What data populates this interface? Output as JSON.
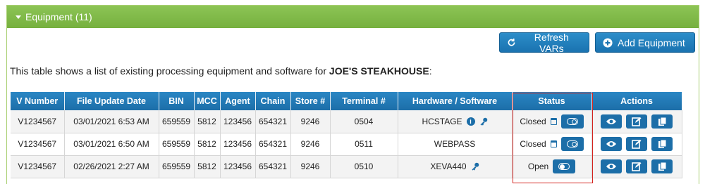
{
  "panel": {
    "title": "Equipment (11)"
  },
  "toolbar": {
    "refresh_label": "Refresh VARs",
    "add_label": "Add Equipment"
  },
  "intro": {
    "text": "This table shows a list of existing processing equipment and software for ",
    "merchant": "JOE'S STEAKHOUSE",
    "suffix": ":"
  },
  "table": {
    "headers": [
      "V Number",
      "File Update Date",
      "BIN",
      "MCC",
      "Agent",
      "Chain",
      "Store #",
      "Terminal #",
      "Hardware / Software",
      "Status",
      "Actions"
    ],
    "rows": [
      {
        "v_number": "V1234567",
        "file_update_date": "03/01/2021 6:53 AM",
        "bin": "659559",
        "mcc": "5812",
        "agent": "123456",
        "chain": "654321",
        "store": "9246",
        "terminal": "0504",
        "hardware": "HCSTAGE",
        "status": "Closed"
      },
      {
        "v_number": "V1234567",
        "file_update_date": "03/01/2021 6:50 AM",
        "bin": "659559",
        "mcc": "5812",
        "agent": "123456",
        "chain": "654321",
        "store": "9246",
        "terminal": "0511",
        "hardware": "WEBPASS",
        "status": "Closed"
      },
      {
        "v_number": "V1234567",
        "file_update_date": "02/26/2021 2:27 AM",
        "bin": "659559",
        "mcc": "5812",
        "agent": "123456",
        "chain": "654321",
        "store": "9246",
        "terminal": "0510",
        "hardware": "XEVA440",
        "status": "Open"
      }
    ]
  },
  "colors": {
    "header_green": "#7ab844",
    "primary_blue": "#1c6ea8",
    "highlight_red": "#d3231e"
  },
  "icons": {
    "refresh": "refresh-icon",
    "add": "plus-circle-icon",
    "info": "info-icon",
    "key": "key-icon",
    "calendar": "calendar-icon",
    "toggle": "toggle-icon",
    "view": "eye-icon",
    "edit": "edit-icon",
    "copy": "copy-icon"
  }
}
